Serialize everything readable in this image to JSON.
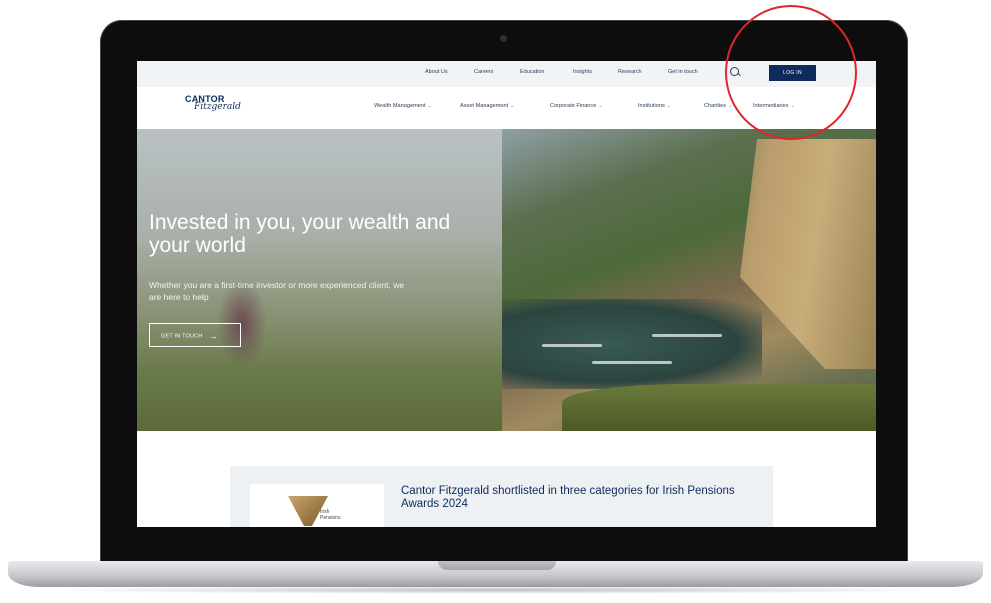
{
  "topbar": {
    "links": [
      "About Us",
      "Careers",
      "Education",
      "Insights",
      "Research",
      "Get in touch"
    ],
    "login_label": "LOG IN"
  },
  "logo": {
    "line1": "CANTOR",
    "line2": "Fitzgerald"
  },
  "main_nav": {
    "items": [
      "Wealth Management",
      "Asset Management",
      "Corporate Finance",
      "Institutions",
      "Charities",
      "Intermediaries"
    ]
  },
  "hero": {
    "title": "Invested in you, your wealth and your world",
    "subtitle": "Whether you are a first-time investor or more experienced client, we are here to help",
    "cta_label": "GET IN TOUCH"
  },
  "news_card": {
    "title": "Cantor Fitzgerald shortlisted in three categories for Irish Pensions Awards 2024",
    "award_text_line1": "Irish",
    "award_text_line2": "Pensions"
  },
  "colors": {
    "brand_navy": "#0e2b5c",
    "annotation_red": "#e0252b"
  }
}
